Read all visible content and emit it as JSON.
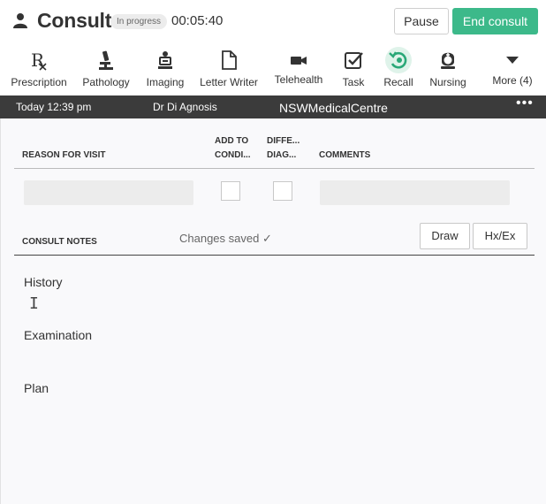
{
  "header": {
    "title": "Consult",
    "status_badge": "In progress",
    "timer": "00:05:40",
    "pause_label": "Pause",
    "end_label": "End consult"
  },
  "toolbar": {
    "items": [
      {
        "label": "Prescription",
        "icon": "prescription-icon"
      },
      {
        "label": "Pathology",
        "icon": "microscope-icon"
      },
      {
        "label": "Imaging",
        "icon": "imaging-icon"
      },
      {
        "label": "Letter Writer",
        "icon": "document-icon"
      },
      {
        "label": "Telehealth",
        "icon": "video-camera-icon"
      },
      {
        "label": "Task",
        "icon": "task-check-icon"
      },
      {
        "label": "Recall",
        "icon": "recall-icon"
      },
      {
        "label": "Nursing",
        "icon": "nurse-icon"
      },
      {
        "label": "More (4)",
        "icon": "caret-down-icon"
      }
    ]
  },
  "infobar": {
    "date": "Today 12:39 pm",
    "doctor": "Dr Di Agnosis",
    "centre": "NSWMedicalCentre",
    "more": "•••"
  },
  "table": {
    "reason_header": "REASON FOR VISIT",
    "add_header_1": "ADD TO",
    "add_header_2": "CONDI...",
    "diff_header_1": "DIFFE...",
    "diff_header_2": "DIAG...",
    "comments_header": "COMMENTS"
  },
  "notes": {
    "label": "CONSULT NOTES",
    "saved": "Changes saved  ✓",
    "draw_label": "Draw",
    "hx_label": "Hx/Ex",
    "history": "History",
    "examination": "Examination",
    "plan": "Plan"
  },
  "colors": {
    "accent": "#3cb98a",
    "infobar": "#3b3b3b"
  }
}
